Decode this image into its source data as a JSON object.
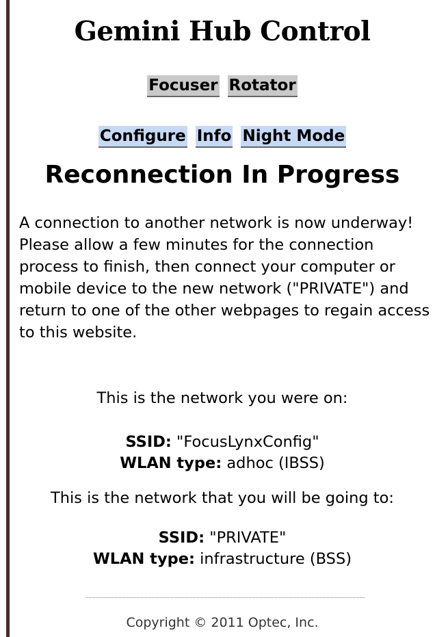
{
  "title": "Gemini Hub Control",
  "nav_primary": [
    {
      "label": "Focuser"
    },
    {
      "label": "Rotator"
    }
  ],
  "nav_secondary": [
    {
      "label": "Configure"
    },
    {
      "label": "Info"
    },
    {
      "label": "Night Mode"
    }
  ],
  "heading": "Reconnection In Progress",
  "message": "A connection to another network is now underway! Please allow a few minutes for the connection process to finish, then connect your computer or mobile device to the new network (\"PRIVATE\") and return to one of the other webpages to regain access to this website.",
  "current_network": {
    "intro": "This is the network you were on:",
    "ssid_label": "SSID:",
    "ssid_value": " \"FocusLynxConfig\"",
    "wlan_label": "WLAN type:",
    "wlan_value": " adhoc (IBSS)"
  },
  "new_network": {
    "intro": "This is the network that you will be going to:",
    "ssid_label": "SSID:",
    "ssid_value": " \"PRIVATE\"",
    "wlan_label": "WLAN type:",
    "wlan_value": " infrastructure (BSS)"
  },
  "footer": "Copyright © 2011 Optec, Inc.",
  "colors": {
    "nav_primary_bg": "#c9c9c9",
    "nav_secondary_bg": "#c6d9f5",
    "left_border": "#4a2a2a"
  }
}
